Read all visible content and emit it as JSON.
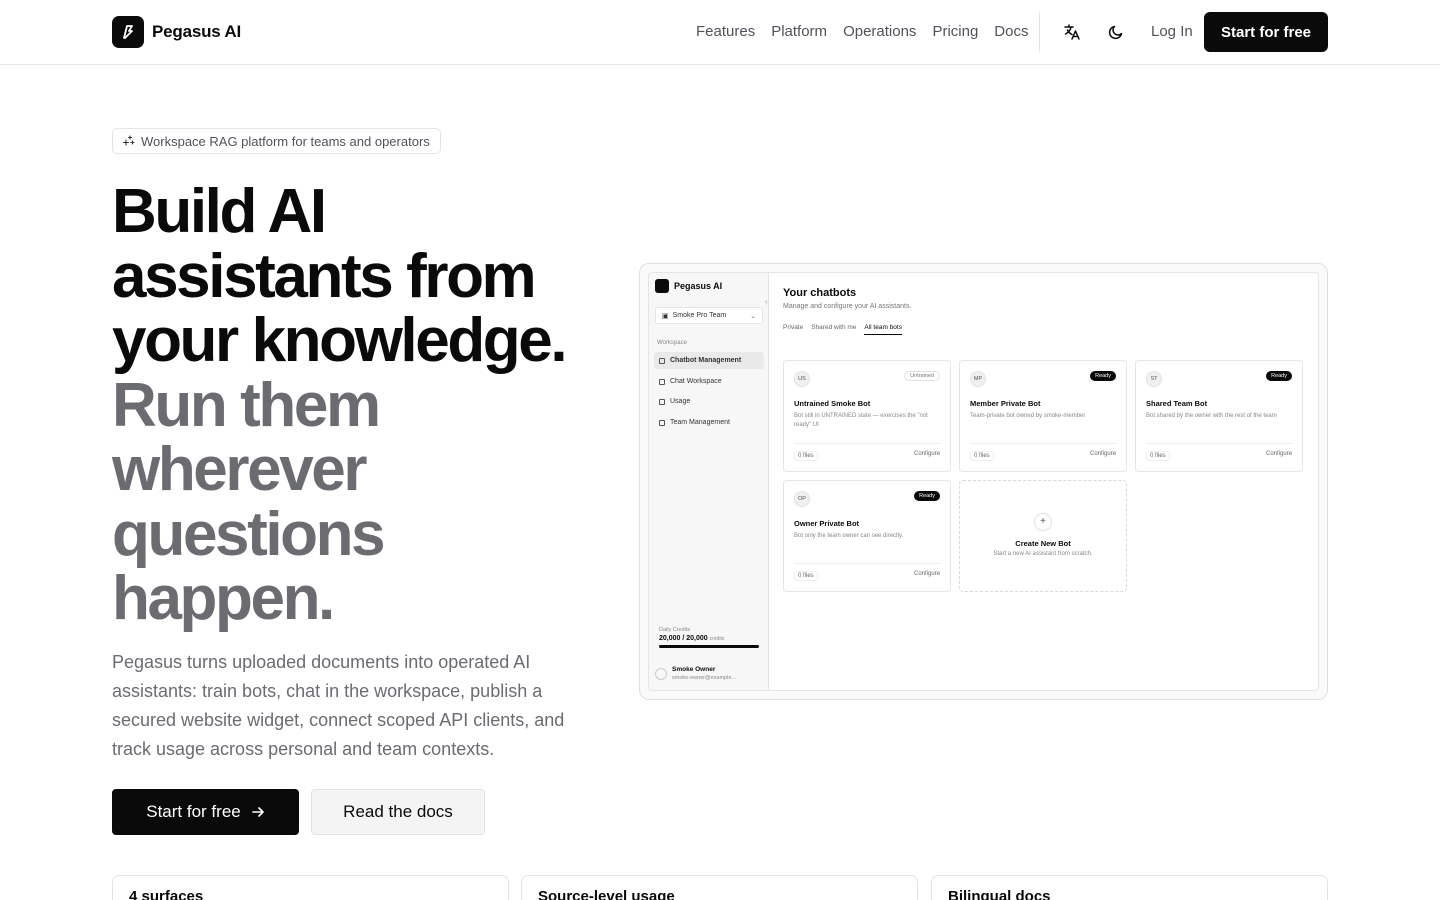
{
  "header": {
    "brand": "Pegasus AI",
    "nav": [
      "Features",
      "Platform",
      "Operations",
      "Pricing",
      "Docs"
    ],
    "language_icon": "translate-icon",
    "theme_icon": "moon-icon",
    "login": "Log In",
    "cta": "Start for free"
  },
  "hero": {
    "badge_icon": "sparkles-icon",
    "badge": "Workspace RAG platform for teams and operators",
    "headline_dark": [
      "Build AI",
      "assistants from",
      "your knowledge."
    ],
    "headline_grey": [
      "Run them",
      "wherever",
      "questions",
      "happen."
    ],
    "lede": "Pegasus turns uploaded documents into operated AI assistants: train bots, chat in the workspace, publish a secured website widget, connect scoped API clients, and track usage across personal and team contexts.",
    "primary_cta": "Start for free",
    "primary_cta_icon": "arrow-right-icon",
    "secondary_cta": "Read the docs"
  },
  "stats": [
    "4 surfaces",
    "Source-level usage",
    "Bilingual docs"
  ],
  "preview": {
    "brand": "Pegasus AI",
    "team": "Smoke Pro Team",
    "section": "Workspace",
    "nav": [
      "Chatbot Management",
      "Chat Workspace",
      "Usage",
      "Team Management"
    ],
    "credits_label": "Daily Credits",
    "credits_value": "20,000 / 20,000",
    "credits_unit": "credits",
    "credits_fraction": 1.0,
    "user_name": "Smoke Owner",
    "user_email": "smoke-owner@example...",
    "title": "Your chatbots",
    "subtitle": "Manage and configure your AI assistants.",
    "tabs": [
      "Private",
      "Shared with me",
      "All team bots"
    ],
    "active_tab": "All team bots",
    "bots": [
      {
        "initials": "US",
        "status": "Untrained",
        "name": "Untrained Smoke Bot",
        "desc": "Bot still in UNTRAINED state — exercises the \"not ready\" UI",
        "files": "0 files",
        "action": "Configure"
      },
      {
        "initials": "MP",
        "status": "Ready",
        "name": "Member Private Bot",
        "desc": "Team-private bot owned by smoke-member",
        "files": "0 files",
        "action": "Configure"
      },
      {
        "initials": "ST",
        "status": "Ready",
        "name": "Shared Team Bot",
        "desc": "Bot shared by the owner with the rest of the team",
        "files": "0 files",
        "action": "Configure"
      },
      {
        "initials": "OP",
        "status": "Ready",
        "name": "Owner Private Bot",
        "desc": "Bot only the team owner can see directly.",
        "files": "0 files",
        "action": "Configure"
      }
    ],
    "create": {
      "title": "Create New Bot",
      "desc": "Start a new AI assistant from scratch."
    }
  }
}
